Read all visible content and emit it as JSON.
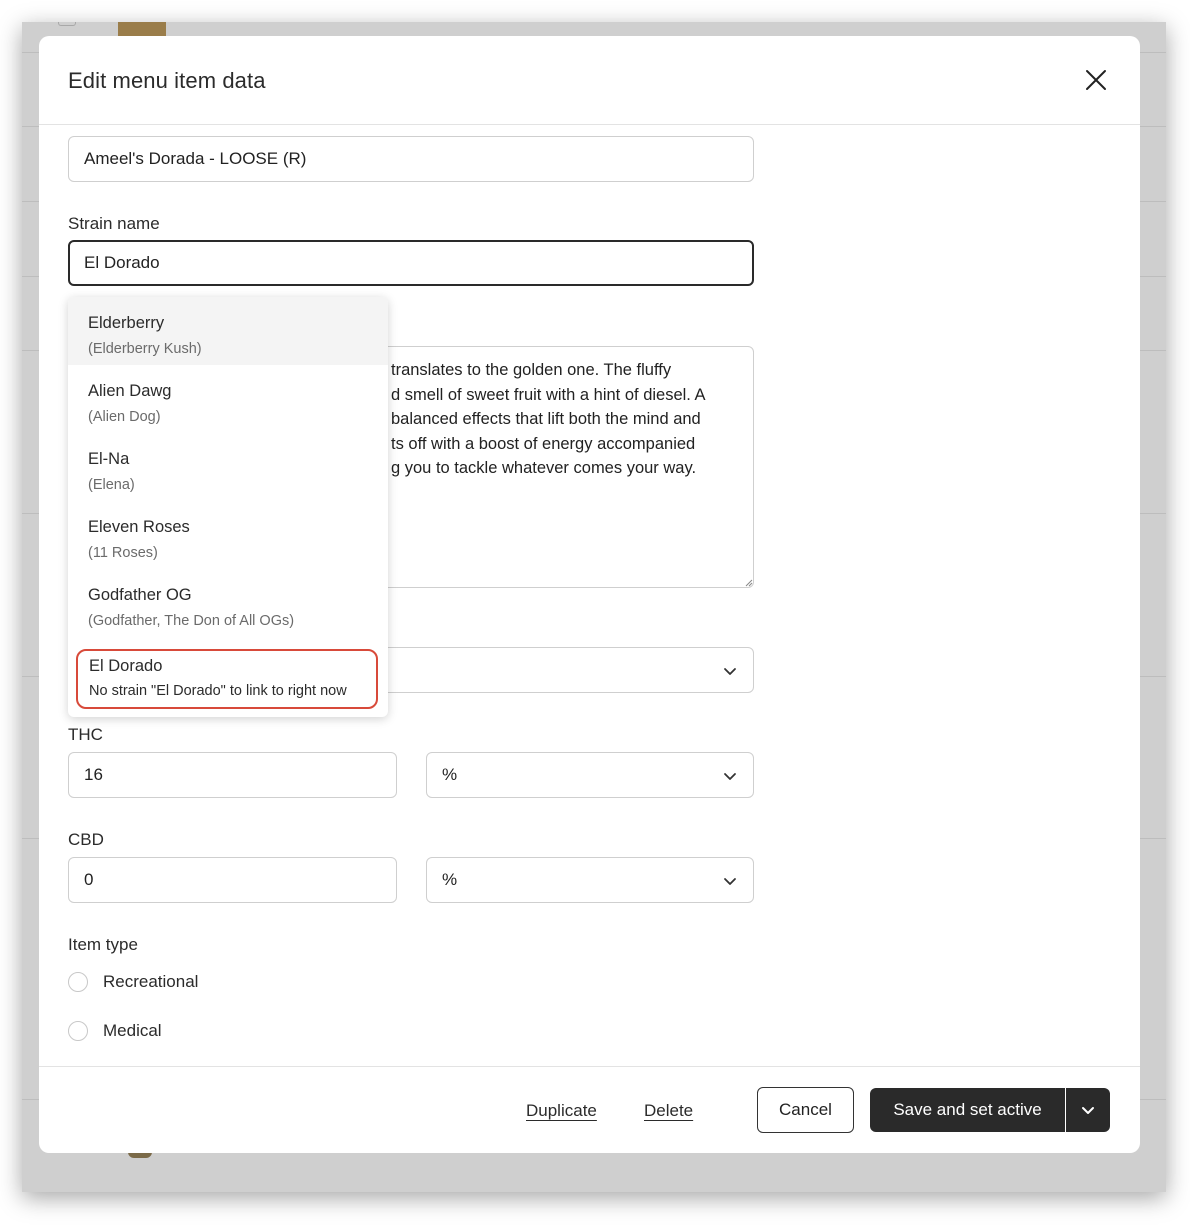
{
  "modal": {
    "title": "Edit menu item data"
  },
  "form": {
    "name_value": "Ameel's Dorada - LOOSE (R)",
    "strain_label": "Strain name",
    "strain_value": "El Dorado",
    "description_visible": "translates to the golden one. The fluffy\nd smell of sweet fruit with a hint of diesel. A\nbalanced effects that lift both the mind and\nts off with a boost of energy accompanied\ng you to tackle whatever comes your way.",
    "thc_label": "THC",
    "thc_value": "16",
    "thc_unit": "%",
    "cbd_label": "CBD",
    "cbd_value": "0",
    "cbd_unit": "%",
    "item_type_label": "Item type",
    "item_types": [
      {
        "label": "Recreational"
      },
      {
        "label": "Medical"
      }
    ]
  },
  "strain_dropdown": {
    "options": [
      {
        "name": "Elderberry",
        "alias": "(Elderberry Kush)"
      },
      {
        "name": "Alien Dawg",
        "alias": "(Alien Dog)"
      },
      {
        "name": "El-Na",
        "alias": "(Elena)"
      },
      {
        "name": "Eleven Roses",
        "alias": "(11 Roses)"
      },
      {
        "name": "Godfather OG",
        "alias": "(Godfather, The Don of All OGs)"
      }
    ],
    "create_option": {
      "name": "El Dorado",
      "note": "No strain \"El Dorado\" to link to right now"
    }
  },
  "footer": {
    "duplicate_label": "Duplicate",
    "delete_label": "Delete",
    "cancel_label": "Cancel",
    "save_label": "Save and set active"
  },
  "colors": {
    "primary_button": "#2a2a2a",
    "highlight_border": "#d84a3a"
  }
}
